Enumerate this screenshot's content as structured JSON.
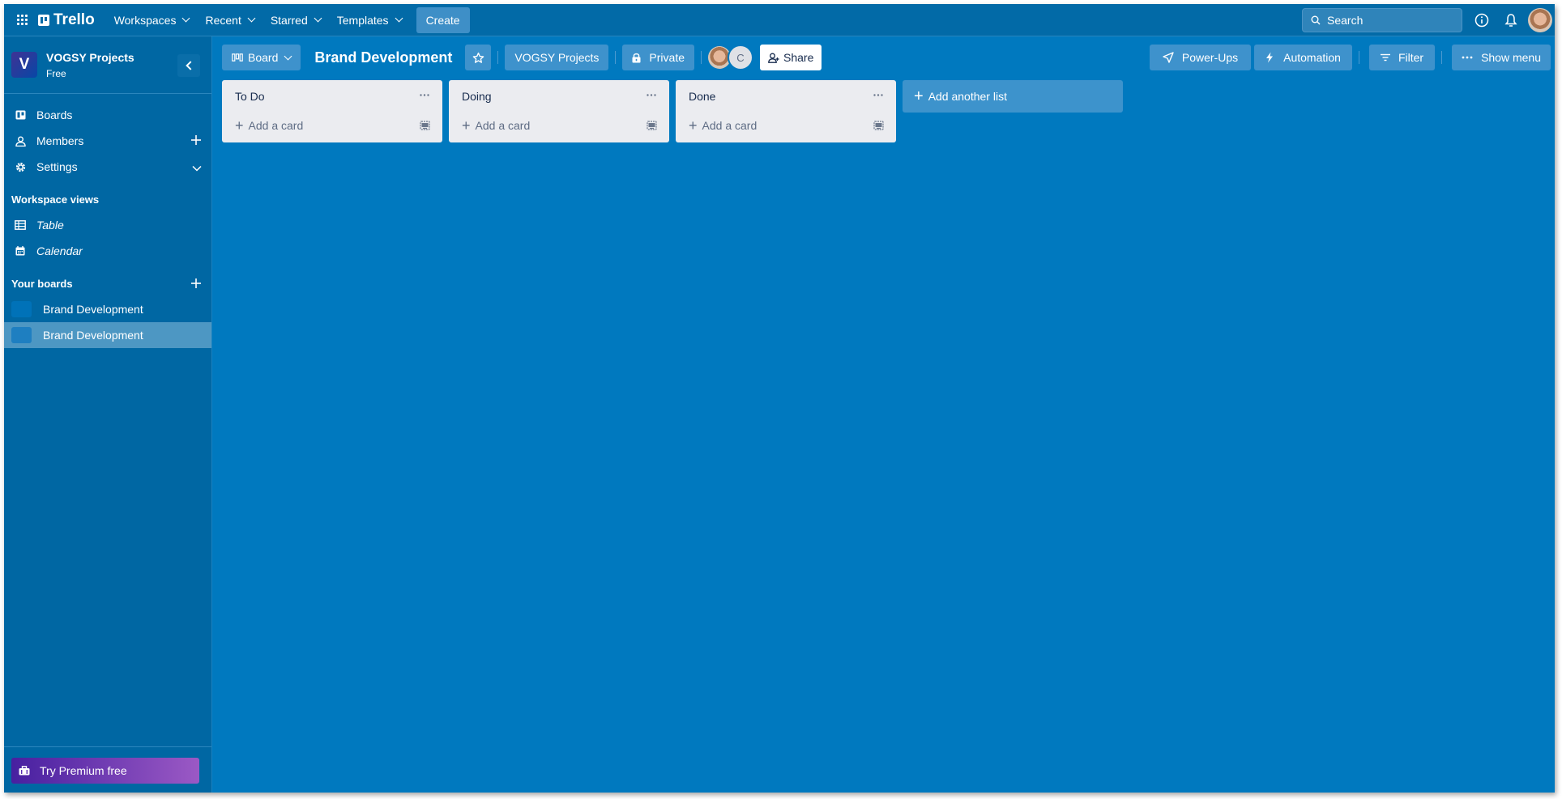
{
  "topnav": {
    "app_name": "Trello",
    "menus": [
      {
        "label": "Workspaces"
      },
      {
        "label": "Recent"
      },
      {
        "label": "Starred"
      },
      {
        "label": "Templates"
      }
    ],
    "create_label": "Create",
    "search_placeholder": "Search"
  },
  "sidebar": {
    "workspace": {
      "initial": "V",
      "name": "VOGSY Projects",
      "plan": "Free"
    },
    "items": [
      {
        "label": "Boards",
        "icon": "board-icon"
      },
      {
        "label": "Members",
        "icon": "person-icon"
      },
      {
        "label": "Settings",
        "icon": "gear-icon"
      }
    ],
    "views_heading": "Workspace views",
    "views": [
      {
        "label": "Table",
        "icon": "table-icon"
      },
      {
        "label": "Calendar",
        "icon": "calendar-icon"
      }
    ],
    "boards_heading": "Your boards",
    "boards": [
      {
        "label": "Brand Development",
        "active": false
      },
      {
        "label": "Brand Development",
        "active": true
      }
    ],
    "premium_label": "Try Premium free"
  },
  "board_header": {
    "view_label": "Board",
    "title": "Brand Development",
    "workspace_label": "VOGSY Projects",
    "visibility_label": "Private",
    "member_initial": "C",
    "share_label": "Share",
    "powerups_label": "Power-Ups",
    "automation_label": "Automation",
    "filter_label": "Filter",
    "menu_label": "Show menu"
  },
  "lists": [
    {
      "title": "To Do",
      "add_card_label": "Add a card"
    },
    {
      "title": "Doing",
      "add_card_label": "Add a card"
    },
    {
      "title": "Done",
      "add_card_label": "Add a card"
    }
  ],
  "add_list_label": "Add another list",
  "colors": {
    "board_bg": "#0079bf",
    "nav_bg": "#026aa7",
    "sidebar_bg": "#0067a3",
    "list_bg": "#ebecf0"
  }
}
